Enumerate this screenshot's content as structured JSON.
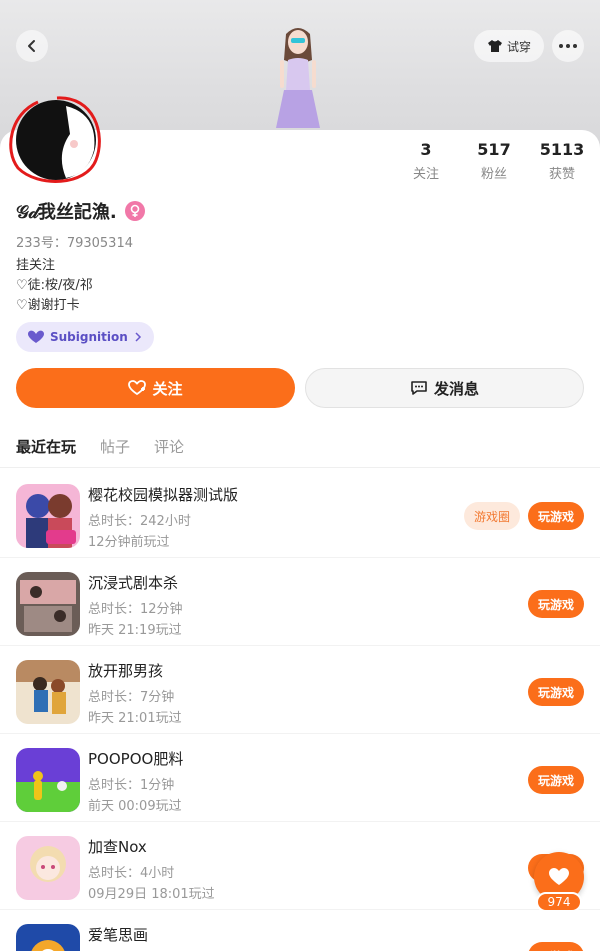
{
  "header": {
    "try_on_label": "试穿"
  },
  "stats": [
    {
      "value": "3",
      "label": "关注"
    },
    {
      "value": "517",
      "label": "粉丝"
    },
    {
      "value": "5113",
      "label": "获赞"
    }
  ],
  "profile": {
    "username": "𝒢𝒹我丝記漁.",
    "id_label": "233号：79305314",
    "bio_lines": [
      "挂关注",
      "♡徒:桉/夜/祁",
      "♡谢谢打卡"
    ],
    "badge_label": "Subignition"
  },
  "actions": {
    "follow_label": "关注",
    "message_label": "发消息"
  },
  "tabs": [
    "最近在玩",
    "帖子",
    "评论"
  ],
  "games": [
    {
      "title": "樱花校园模拟器测试版",
      "playtime": "总时长：242小时",
      "last_played": "12分钟前玩过",
      "circle_label": "游戏圈",
      "play_label": "玩游戏"
    },
    {
      "title": "沉浸式剧本杀",
      "playtime": "总时长：12分钟",
      "last_played": "昨天 21:19玩过",
      "play_label": "玩游戏"
    },
    {
      "title": "放开那男孩",
      "playtime": "总时长：7分钟",
      "last_played": "昨天 21:01玩过",
      "play_label": "玩游戏"
    },
    {
      "title": "POOPOO肥料",
      "playtime": "总时长：1分钟",
      "last_played": "前天 00:09玩过",
      "play_label": "玩游戏"
    },
    {
      "title": "加查Nox",
      "playtime": "总时长：4小时",
      "last_played": "09月29日 18:01玩过",
      "play_label": "玩游戏"
    },
    {
      "title": "爱笔思画",
      "playtime": "",
      "last_played": "",
      "play_label": "玩游戏"
    }
  ],
  "floating": {
    "like_count": "974"
  },
  "colors": {
    "accent": "#fb6e1a",
    "badge_text": "#5b4fc4",
    "gender": "#f178a8"
  }
}
